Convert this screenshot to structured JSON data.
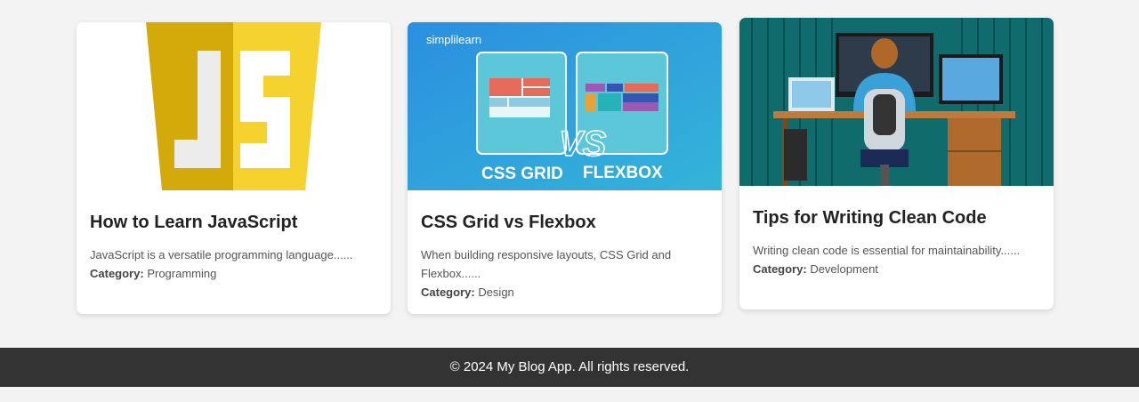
{
  "posts": [
    {
      "title": "How to Learn JavaScript",
      "description": "JavaScript is a versatile programming language......",
      "category_label": "Category:",
      "category": "Programming",
      "image": {
        "icon": "javascript-logo-icon",
        "logo_text": "JS"
      }
    },
    {
      "title": "CSS Grid vs Flexbox",
      "description": "When building responsive layouts, CSS Grid and Flexbox......",
      "category_label": "Category:",
      "category": "Design",
      "image": {
        "brand": "simplilearn",
        "left_text": "CSS GRID",
        "right_text": "FLEXBOX",
        "vs_text": "VS"
      }
    },
    {
      "title": "Tips for Writing Clean Code",
      "description": "Writing clean code is essential for maintainability......",
      "category_label": "Category:",
      "category": "Development",
      "image": {
        "icon": "developer-at-desk-illustration"
      }
    }
  ],
  "footer": {
    "text": "© 2024 My Blog App. All rights reserved."
  },
  "colors": {
    "background": "#f3f3f3",
    "footer": "#333333",
    "js_yellow": "#f0d000",
    "css_blue": "#2a9fd8",
    "teal": "#0e6e70"
  }
}
